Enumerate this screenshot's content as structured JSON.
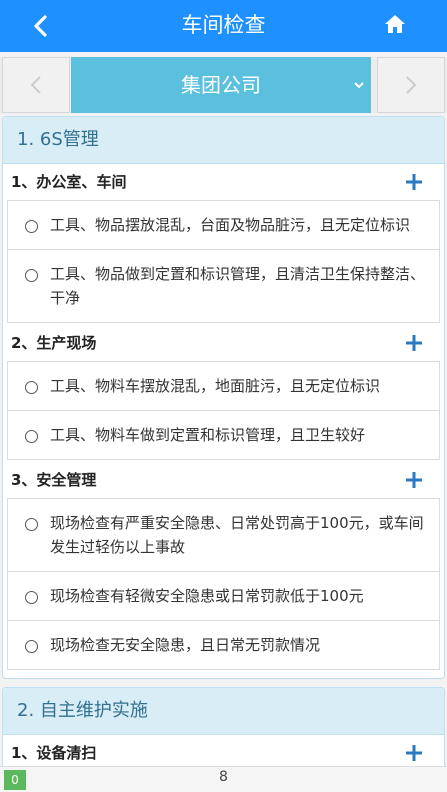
{
  "header": {
    "title": "车间检查",
    "back_icon": "chevron-left-icon",
    "home_icon": "home-icon"
  },
  "selector": {
    "company": "集团公司"
  },
  "sections": [
    {
      "title": "1. 6S管理",
      "groups": [
        {
          "title": "1、办公室、车间",
          "options": [
            "工具、物品摆放混乱，台面及物品脏污，且无定位标识",
            "工具、物品做到定置和标识管理，且清洁卫生保持整洁、干净"
          ]
        },
        {
          "title": "2、生产现场",
          "options": [
            "工具、物料车摆放混乱，地面脏污，且无定位标识",
            "工具、物料车做到定置和标识管理，且卫生较好"
          ]
        },
        {
          "title": "3、安全管理",
          "options": [
            "现场检查有严重安全隐患、日常处罚高于100元，或车间发生过轻伤以上事故",
            "现场检查有轻微安全隐患或日常罚款低于100元",
            "现场检查无安全隐患，且日常无罚款情况"
          ]
        }
      ]
    },
    {
      "title": "2. 自主维护实施",
      "groups": [
        {
          "title": "1、设备清扫",
          "options": []
        }
      ]
    }
  ],
  "footer": {
    "badge": "0",
    "page": "8"
  },
  "colors": {
    "header": "#1f90ff",
    "selector": "#5bc0de",
    "plus": "#2a7abf",
    "badge": "#5cb85c"
  }
}
